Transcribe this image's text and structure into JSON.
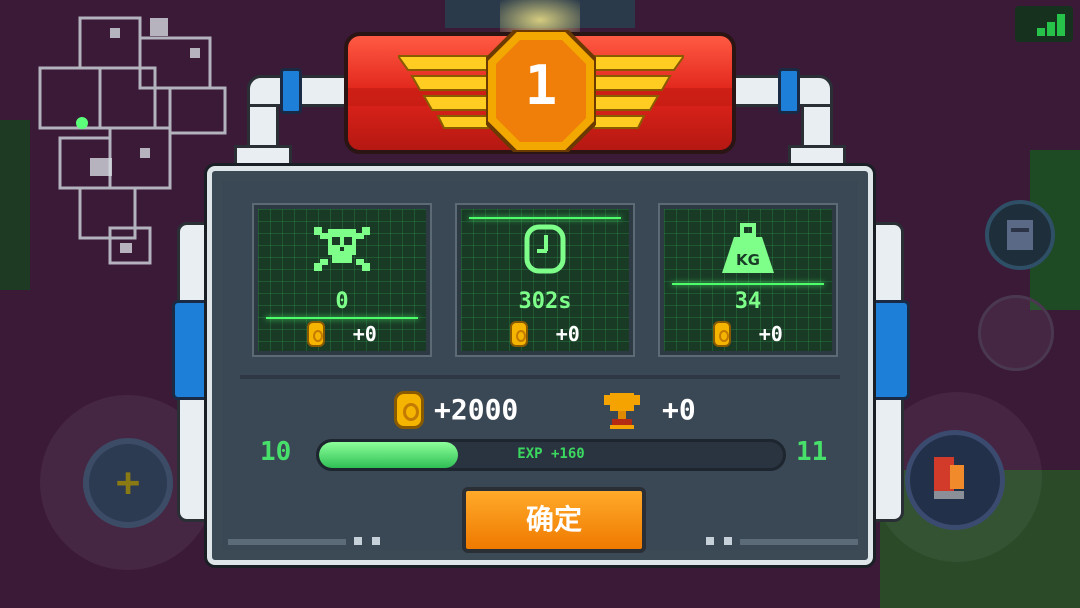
{
  "rank_badge": {
    "number": "1"
  },
  "stats": [
    {
      "icon": "skull-crossbones-icon",
      "value": "0",
      "reward": "+0"
    },
    {
      "icon": "clock-icon",
      "value": "302s",
      "reward": "+0"
    },
    {
      "icon": "weight-kg-icon",
      "value": "34",
      "icon_text": "KG",
      "reward": "+0"
    }
  ],
  "totals": {
    "gold": "+2000",
    "trophy": "+0"
  },
  "experience": {
    "current_level": "10",
    "next_level": "11",
    "label": "EXP +160",
    "progress": 0.3
  },
  "confirm_button": {
    "label": "确定"
  },
  "colors": {
    "panel": "#3c4a56",
    "screen_green": "#7dff8a",
    "confirm_orange": "#ff9a1a",
    "banner_red": "#e0241a",
    "exp_green": "#47e06a"
  }
}
